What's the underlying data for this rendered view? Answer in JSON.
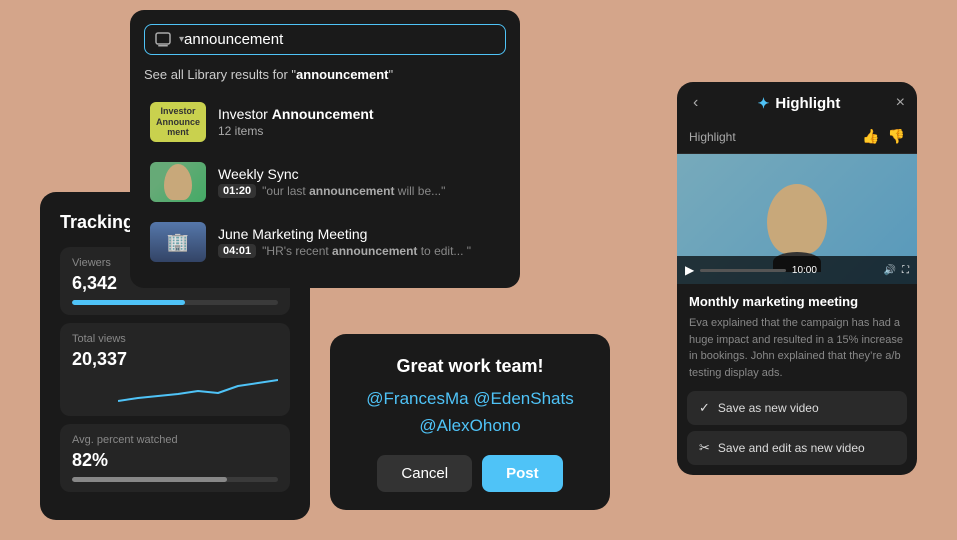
{
  "background_color": "#d4a58a",
  "search": {
    "placeholder": "announcement",
    "input_value": "announcement",
    "hint_prefix": "See all Library results for ",
    "hint_query": "announcement",
    "results": [
      {
        "id": "investor",
        "thumb_type": "investor",
        "thumb_label": "Investor\nAnnouncement",
        "title_plain": "Investor ",
        "title_bold": "Announcement",
        "meta_type": "count",
        "meta_value": "12 items"
      },
      {
        "id": "weekly",
        "thumb_type": "person",
        "title_plain": "Weekly Sync",
        "meta_type": "time",
        "time_badge": "01:20",
        "snippet_plain": "“our last ",
        "snippet_bold": "announcement",
        "snippet_suffix": " will be...”"
      },
      {
        "id": "june",
        "thumb_type": "building",
        "title_plain": "June Marketing Meeting",
        "meta_type": "time",
        "time_badge": "04:01",
        "snippet_plain": "“HR’s recent ",
        "snippet_bold": "announcement",
        "snippet_suffix": " to edit... ”"
      }
    ]
  },
  "tracking": {
    "title": "Tracking",
    "stats": [
      {
        "label": "Viewers",
        "value": "6,342",
        "bar_percent": 55,
        "type": "bar"
      },
      {
        "label": "Total views",
        "value": "20,337",
        "type": "sparkline"
      },
      {
        "label": "Avg. percent watched",
        "value": "82%",
        "bar_percent": 75,
        "type": "bar"
      }
    ]
  },
  "mention": {
    "title": "Great work team!",
    "tags": "@FrancesMa @EdenShats\n@AlexOhono",
    "cancel_label": "Cancel",
    "post_label": "Post"
  },
  "highlight": {
    "title": "Highlight",
    "back_label": "‹",
    "close_label": "×",
    "section_label": "Highlight",
    "thumbup_label": "👍",
    "thumbdown_label": "👎",
    "video_time": "10:00",
    "video_title": "Monthly marketing meeting",
    "video_desc": "Eva explained that the campaign has had a huge impact and resulted in a 15% increase in bookings. John explained that they’re a/b testing display ads.",
    "action1_label": "Save as new video",
    "action2_label": "Save and edit as new video"
  }
}
